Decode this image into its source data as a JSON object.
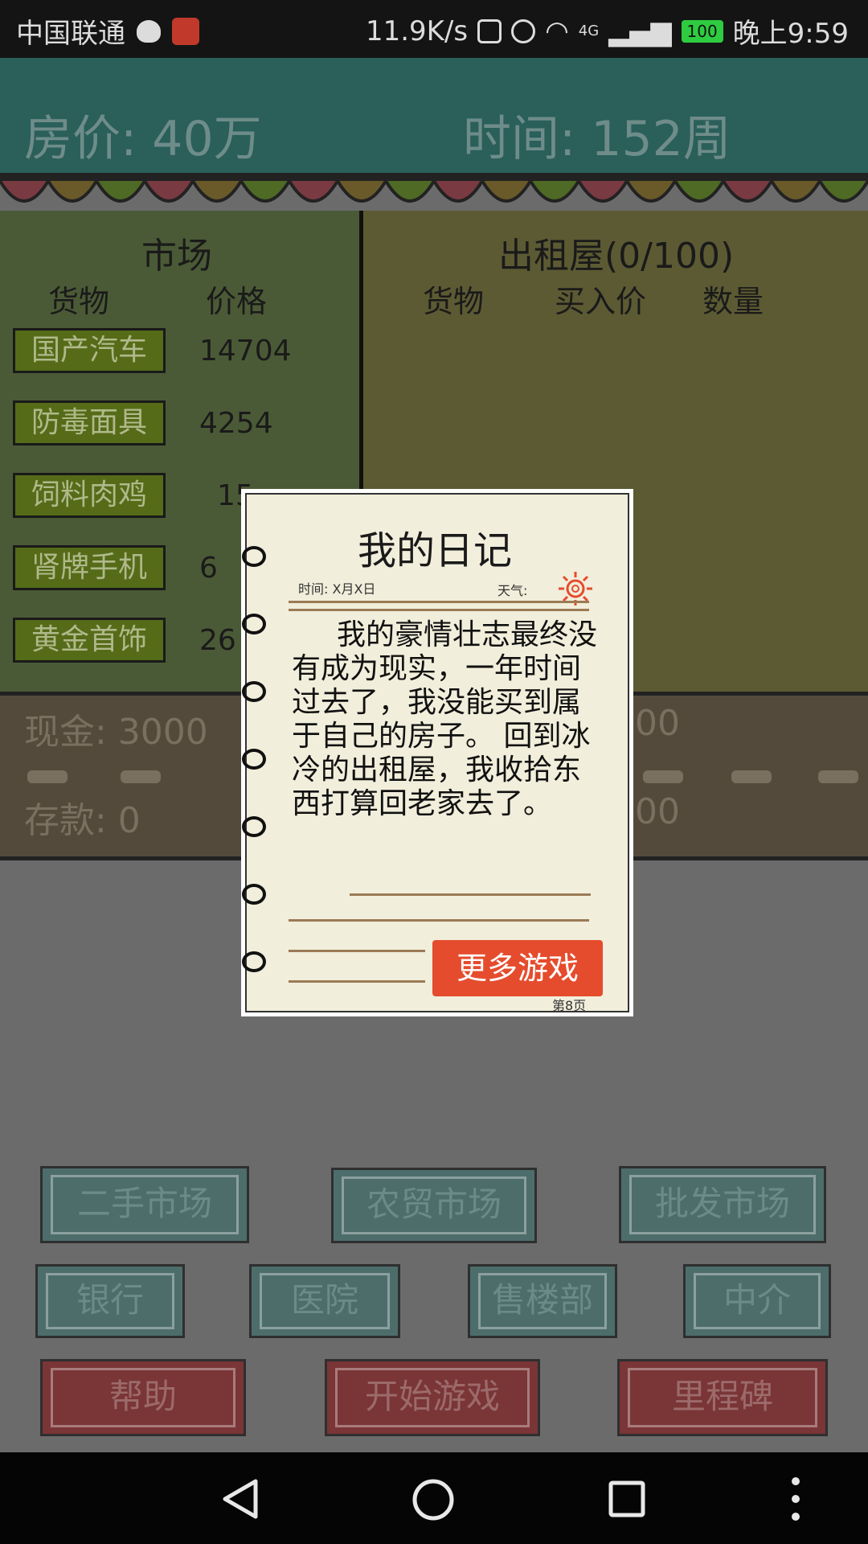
{
  "status_bar": {
    "carrier": "中国联通",
    "speed": "11.9K/s",
    "network": "4G",
    "battery": "100",
    "time": "晚上9:59"
  },
  "header": {
    "house_price": "房价:  40万",
    "time": "时间:  152周"
  },
  "market": {
    "title": "市场",
    "col_goods": "货物",
    "col_price": "价格",
    "items": [
      {
        "name": "国产汽车",
        "price": "14704"
      },
      {
        "name": "防毒面具",
        "price": "4254"
      },
      {
        "name": "饲料肉鸡",
        "price": "15"
      },
      {
        "name": "肾牌手机",
        "price": "6"
      },
      {
        "name": "黄金首饰",
        "price": "26"
      }
    ]
  },
  "rental": {
    "title": "出租屋(0/100)",
    "col_goods": "货物",
    "col_buy_price": "买入价",
    "col_qty": "数量"
  },
  "finance": {
    "cash": "现金: 3000",
    "deposit": "存款: 0",
    "right_top": "00",
    "right_bottom": "00"
  },
  "buttons": {
    "second_hand": "二手市场",
    "farm": "农贸市场",
    "wholesale": "批发市场",
    "bank": "银行",
    "hospital": "医院",
    "sales": "售楼部",
    "agent": "中介",
    "help": "帮助",
    "start": "开始游戏",
    "milestone": "里程碑"
  },
  "diary": {
    "title": "我的日记",
    "date_label": "时间: X月X日",
    "weather_label": "天气:",
    "body": "我的豪情壮志最终没有成为现实，一年时间过去了，我没能买到属于自己的房子。 回到冰冷的出租屋，我收拾东西打算回老家去了。",
    "more_games": "更多游戏",
    "page": "第8页"
  },
  "colors": {
    "header_bg": "#2a5f5a",
    "diary_bg": "#f1eedb",
    "more_btn": "#e54c2d"
  }
}
